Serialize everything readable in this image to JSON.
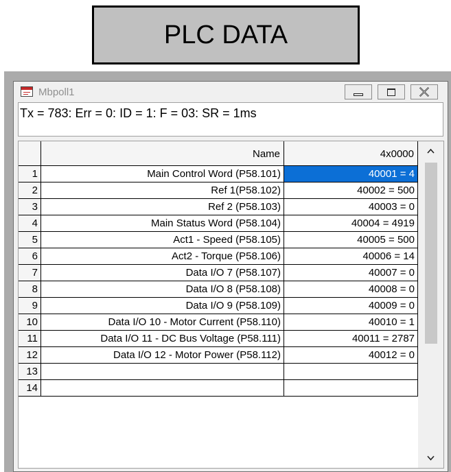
{
  "banner": {
    "title": "PLC DATA"
  },
  "window": {
    "title": "Mbpoll1",
    "status": "Tx = 783: Err = 0: ID = 1: F = 03: SR = 1ms"
  },
  "grid": {
    "columns": [
      "Name",
      "4x0000"
    ],
    "rows": [
      {
        "num": "1",
        "name": "Main Control Word (P58.101)",
        "value": "40001 = 4"
      },
      {
        "num": "2",
        "name": "Ref 1(P58.102)",
        "value": "40002 = 500"
      },
      {
        "num": "3",
        "name": "Ref 2 (P58.103)",
        "value": "40003 = 0"
      },
      {
        "num": "4",
        "name": "Main Status Word (P58.104)",
        "value": "40004 = 4919"
      },
      {
        "num": "5",
        "name": "Act1 - Speed (P58.105)",
        "value": "40005 = 500"
      },
      {
        "num": "6",
        "name": "Act2 - Torque (P58.106)",
        "value": "40006 = 14"
      },
      {
        "num": "7",
        "name": "Data I/O 7 (P58.107)",
        "value": "40007 = 0"
      },
      {
        "num": "8",
        "name": "Data I/O 8 (P58.108)",
        "value": "40008 = 0"
      },
      {
        "num": "9",
        "name": "Data I/O 9 (P58.109)",
        "value": "40009 = 0"
      },
      {
        "num": "10",
        "name": "Data I/O 10 - Motor Current (P58.110)",
        "value": "40010 = 1"
      },
      {
        "num": "11",
        "name": "Data I/O 11 - DC Bus Voltage (P58.111)",
        "value": "40011 = 2787"
      },
      {
        "num": "12",
        "name": "Data I/O 12 - Motor Power (P58.112)",
        "value": "40012 = 0"
      },
      {
        "num": "13",
        "name": "",
        "value": ""
      },
      {
        "num": "14",
        "name": "",
        "value": ""
      }
    ]
  },
  "colors": {
    "selection": "#0c6fd6",
    "title_text": "#8f8f8f"
  },
  "icons": [
    "app-icon",
    "minimize-icon",
    "maximize-icon",
    "close-icon",
    "scroll-up-icon",
    "scroll-down-icon"
  ]
}
